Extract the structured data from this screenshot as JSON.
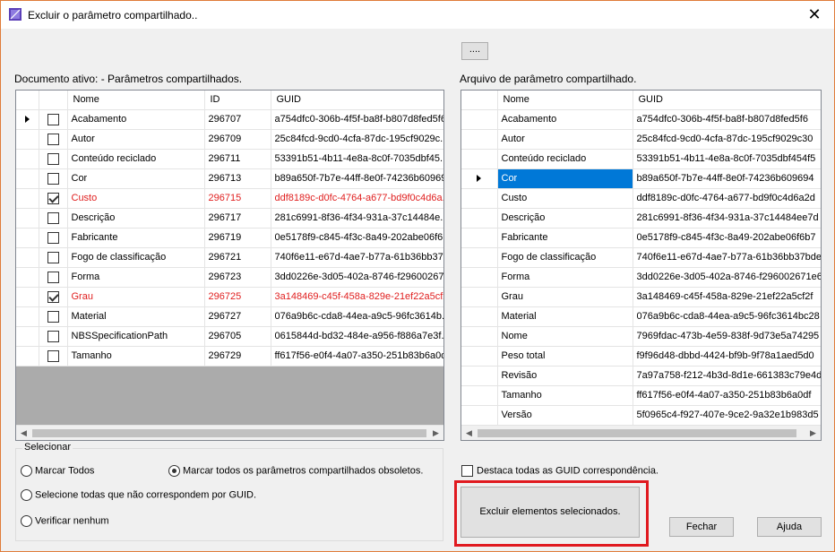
{
  "window": {
    "title": "Excluir o parâmetro compartilhado..",
    "close_glyph": "✕"
  },
  "browse_button_label": "....",
  "left_panel": {
    "label": "Documento ativo: - Parâmetros compartilhados.",
    "columns": [
      "Nome",
      "ID",
      "GUID"
    ],
    "rows": [
      {
        "checked": false,
        "name": "Acabamento",
        "id": "296707",
        "guid": "a754dfc0-306b-4f5f-ba8f-b807d8fed5f6",
        "obsolete": false,
        "current": true
      },
      {
        "checked": false,
        "name": "Autor",
        "id": "296709",
        "guid": "25c84fcd-9cd0-4cfa-87dc-195cf9029c...",
        "obsolete": false,
        "current": false
      },
      {
        "checked": false,
        "name": "Conteúdo reciclado",
        "id": "296711",
        "guid": "53391b51-4b11-4e8a-8c0f-7035dbf45...",
        "obsolete": false,
        "current": false
      },
      {
        "checked": false,
        "name": "Cor",
        "id": "296713",
        "guid": "b89a650f-7b7e-44ff-8e0f-74236b60969...",
        "obsolete": false,
        "current": false
      },
      {
        "checked": true,
        "name": "Custo",
        "id": "296715",
        "guid": "ddf8189c-d0fc-4764-a677-bd9f0c4d6a...",
        "obsolete": true,
        "current": false
      },
      {
        "checked": false,
        "name": "Descrição",
        "id": "296717",
        "guid": "281c6991-8f36-4f34-931a-37c14484e...",
        "obsolete": false,
        "current": false
      },
      {
        "checked": false,
        "name": "Fabricante",
        "id": "296719",
        "guid": "0e5178f9-c845-4f3c-8a49-202abe06f6...",
        "obsolete": false,
        "current": false
      },
      {
        "checked": false,
        "name": "Fogo de classificação",
        "id": "296721",
        "guid": "740f6e11-e67d-4ae7-b77a-61b36bb37...",
        "obsolete": false,
        "current": false
      },
      {
        "checked": false,
        "name": "Forma",
        "id": "296723",
        "guid": "3dd0226e-3d05-402a-8746-f29600267...",
        "obsolete": false,
        "current": false
      },
      {
        "checked": true,
        "name": "Grau",
        "id": "296725",
        "guid": "3a148469-c45f-458a-829e-21ef22a5cf2...",
        "obsolete": true,
        "current": false
      },
      {
        "checked": false,
        "name": "Material",
        "id": "296727",
        "guid": "076a9b6c-cda8-44ea-a9c5-96fc3614b...",
        "obsolete": false,
        "current": false
      },
      {
        "checked": false,
        "name": "NBSSpecificationPath",
        "id": "296705",
        "guid": "0615844d-bd32-484e-a956-f886a7e3f...",
        "obsolete": false,
        "current": false
      },
      {
        "checked": false,
        "name": "Tamanho",
        "id": "296729",
        "guid": "ff617f56-e0f4-4a07-a350-251b83b6a0d...",
        "obsolete": false,
        "current": false
      }
    ]
  },
  "right_panel": {
    "label": "Arquivo de parâmetro compartilhado.",
    "columns": [
      "Nome",
      "GUID"
    ],
    "rows": [
      {
        "name": "Acabamento",
        "guid": "a754dfc0-306b-4f5f-ba8f-b807d8fed5f6",
        "current": false,
        "selected": false
      },
      {
        "name": "Autor",
        "guid": "25c84fcd-9cd0-4cfa-87dc-195cf9029c30",
        "current": false,
        "selected": false
      },
      {
        "name": "Conteúdo reciclado",
        "guid": "53391b51-4b11-4e8a-8c0f-7035dbf454f5",
        "current": false,
        "selected": false
      },
      {
        "name": "Cor",
        "guid": "b89a650f-7b7e-44ff-8e0f-74236b609694",
        "current": true,
        "selected": true
      },
      {
        "name": "Custo",
        "guid": "ddf8189c-d0fc-4764-a677-bd9f0c4d6a2d",
        "current": false,
        "selected": false
      },
      {
        "name": "Descrição",
        "guid": "281c6991-8f36-4f34-931a-37c14484ee7d",
        "current": false,
        "selected": false
      },
      {
        "name": "Fabricante",
        "guid": "0e5178f9-c845-4f3c-8a49-202abe06f6b7",
        "current": false,
        "selected": false
      },
      {
        "name": "Fogo de classificação",
        "guid": "740f6e11-e67d-4ae7-b77a-61b36bb37bde",
        "current": false,
        "selected": false
      },
      {
        "name": "Forma",
        "guid": "3dd0226e-3d05-402a-8746-f296002671e6",
        "current": false,
        "selected": false
      },
      {
        "name": "Grau",
        "guid": "3a148469-c45f-458a-829e-21ef22a5cf2f",
        "current": false,
        "selected": false
      },
      {
        "name": "Material",
        "guid": "076a9b6c-cda8-44ea-a9c5-96fc3614bc28",
        "current": false,
        "selected": false
      },
      {
        "name": "Nome",
        "guid": "7969fdac-473b-4e59-838f-9d73e5a74295",
        "current": false,
        "selected": false
      },
      {
        "name": "Peso total",
        "guid": "f9f96d48-dbbd-4424-bf9b-9f78a1aed5d0",
        "current": false,
        "selected": false
      },
      {
        "name": "Revisão",
        "guid": "7a97a758-f212-4b3d-8d1e-661383c79e4d",
        "current": false,
        "selected": false
      },
      {
        "name": "Tamanho",
        "guid": "ff617f56-e0f4-4a07-a350-251b83b6a0df",
        "current": false,
        "selected": false
      },
      {
        "name": "Versão",
        "guid": "5f0965c4-f927-407e-9ce2-9a32e1b983d5",
        "current": false,
        "selected": false
      }
    ]
  },
  "select_group": {
    "legend": "Selecionar",
    "options": {
      "mark_all": "Marcar Todos",
      "mark_obsolete": "Marcar todos os parâmetros compartilhados obsoletos.",
      "select_unmatched": "Selecione todas que não correspondem por GUID.",
      "check_none": "Verificar nenhum"
    },
    "selected": "mark_obsolete"
  },
  "highlight_checkbox": {
    "label": "Destaca todas as GUID correspondência.",
    "checked": false
  },
  "buttons": {
    "delete_selected": "Excluir elementos selecionados.",
    "close": "Fechar",
    "help": "Ajuda"
  },
  "colors": {
    "obsolete_text": "#e02020",
    "selection": "#0078d7",
    "highlight_frame": "#e0191f"
  }
}
